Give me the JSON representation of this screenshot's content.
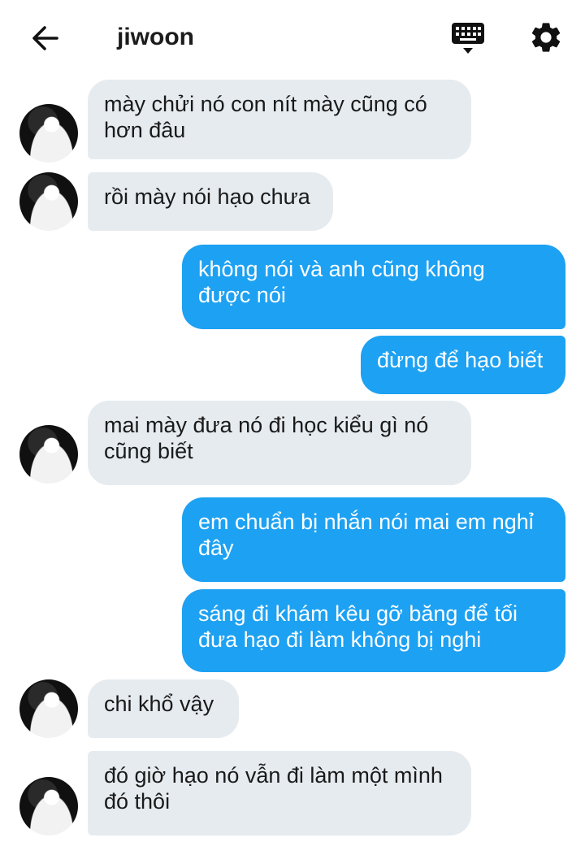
{
  "header": {
    "back_icon": "arrow-left-icon",
    "title": "jiwoon",
    "keyboard_icon": "keyboard-icon",
    "settings_icon": "gear-icon"
  },
  "messages": [
    {
      "side": "in",
      "text": "mày chửi nó con nít mày cũng có\nhơn đâu"
    },
    {
      "side": "in",
      "text": "rồi mày nói hạo chưa"
    },
    {
      "side": "out",
      "text": "không nói và anh cũng không\nđược nói"
    },
    {
      "side": "out",
      "text": "đừng để hạo biết"
    },
    {
      "side": "in",
      "text": "mai mày đưa nó đi học kiểu gì nó\ncũng biết"
    },
    {
      "side": "out",
      "text": "em chuẩn bị nhắn nói mai em nghỉ\nđây"
    },
    {
      "side": "out",
      "text": "sáng đi khám kêu gỡ băng để tối\nđưa hạo đi làm không bị nghi"
    },
    {
      "side": "in",
      "text": "chi khổ vậy"
    },
    {
      "side": "in",
      "text": "đó giờ hạo nó vẫn đi làm một mình\nđó thôi"
    }
  ]
}
